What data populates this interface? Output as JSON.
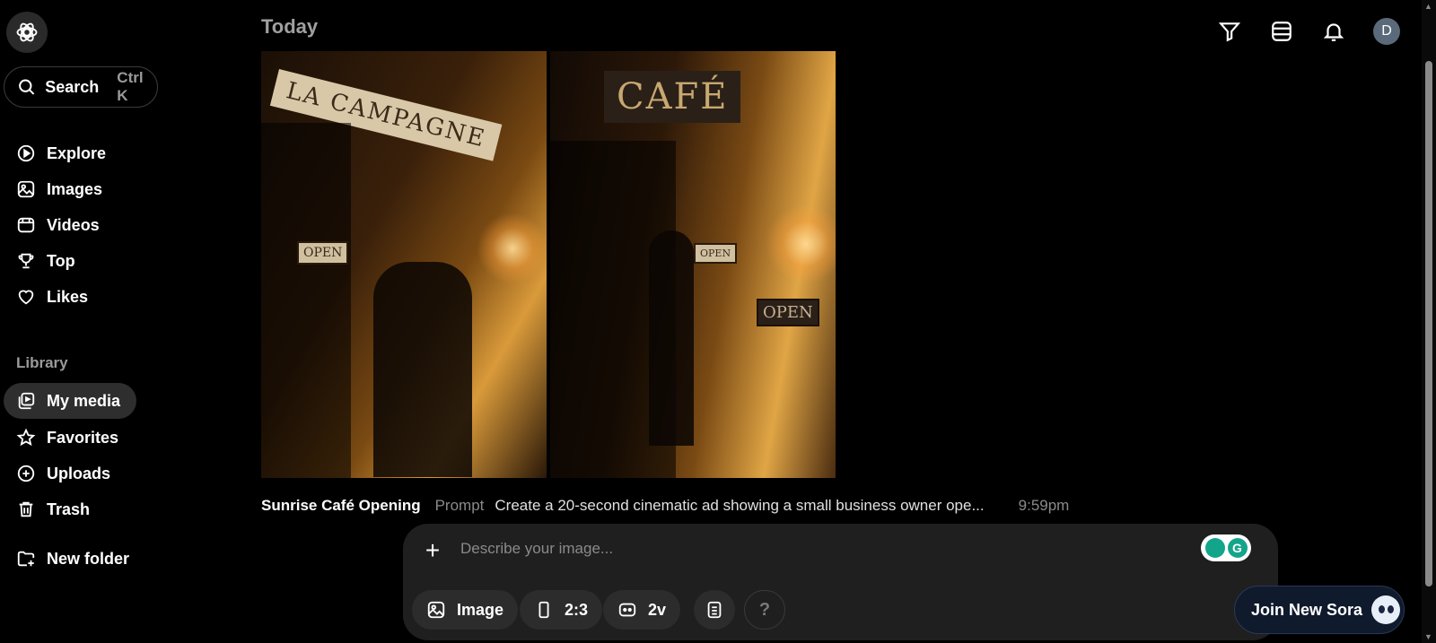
{
  "sidebar": {
    "search": {
      "label": "Search",
      "shortcut": "Ctrl K"
    },
    "nav": [
      {
        "label": "Explore"
      },
      {
        "label": "Images"
      },
      {
        "label": "Videos"
      },
      {
        "label": "Top"
      },
      {
        "label": "Likes"
      }
    ],
    "library_label": "Library",
    "library": [
      {
        "label": "My media",
        "active": true
      },
      {
        "label": "Favorites"
      },
      {
        "label": "Uploads"
      },
      {
        "label": "Trash"
      }
    ],
    "new_folder": "New folder"
  },
  "header": {
    "section_title": "Today",
    "avatar_initial": "D"
  },
  "media": {
    "frame1_sign": "LA CAMPAGNE",
    "frame1_tag": "OPEN",
    "frame2_sign": "CAFÉ",
    "frame2_tag": "OPEN",
    "frame2_board": "OPEN"
  },
  "caption": {
    "title": "Sunrise Café Opening",
    "prompt_label": "Prompt",
    "prompt_text": "Create a 20-second cinematic ad showing a small business owner ope...",
    "time": "9:59pm"
  },
  "composer": {
    "placeholder": "Describe your image...",
    "chips": {
      "type": "Image",
      "aspect": "2:3",
      "variations": "2v",
      "help": "?"
    }
  },
  "join_button": "Join New Sora"
}
